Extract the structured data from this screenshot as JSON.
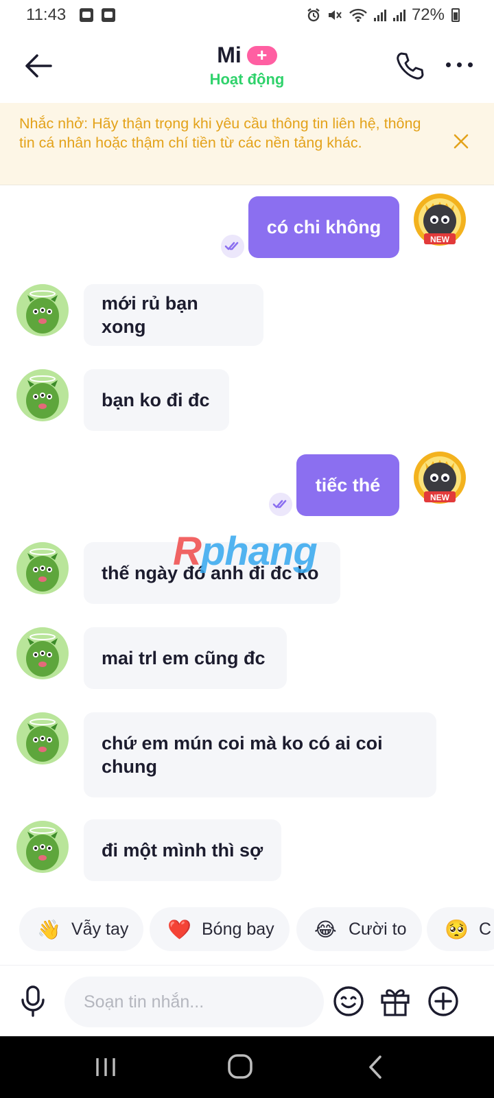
{
  "status_bar": {
    "time": "11:43",
    "battery": "72%",
    "icons": [
      "image-icon",
      "clock-icon",
      "alarm-icon",
      "mute-icon",
      "wifi-icon",
      "signal-icon",
      "signal-icon",
      "battery-icon"
    ]
  },
  "header": {
    "name": "Mi",
    "badge": "+",
    "status": "Hoạt động"
  },
  "banner": {
    "text": "Nhắc nhở: Hãy thận trọng khi yêu cầu thông tin liên hệ, thông tin cá nhân hoặc thậm chí tiền từ các nền tảng khác."
  },
  "messages": [
    {
      "side": "out",
      "text": "có chi không"
    },
    {
      "side": "in",
      "text": "mới rủ bạn xong"
    },
    {
      "side": "in",
      "text": "bạn ko đi đc"
    },
    {
      "side": "out",
      "text": "tiếc thé"
    },
    {
      "side": "in",
      "text": "thế ngày đó anh đi đc ko"
    },
    {
      "side": "in",
      "text": "mai trl em cũng đc"
    },
    {
      "side": "in",
      "text": "chứ em mún coi mà ko có ai coi chung"
    },
    {
      "side": "in",
      "text": "đi một mình thì sợ"
    }
  ],
  "watermark": {
    "first": "R",
    "rest": "phang"
  },
  "avatar_badge": "NEW",
  "quick_reactions": [
    {
      "emoji": "👋",
      "label": "Vẫy tay"
    },
    {
      "emoji": "❤️",
      "label": "Bóng bay"
    },
    {
      "emoji": "😂",
      "label": "Cười to"
    },
    {
      "emoji": "🥺",
      "label": "C"
    }
  ],
  "composer": {
    "placeholder": "Soạn tin nhắn...",
    "value": ""
  },
  "colors": {
    "accent": "#8b6ff0",
    "active_green": "#2fd26b",
    "banner_text": "#e3a21a",
    "banner_bg": "#fdf6e6",
    "badge_pink": "#ff5fa2"
  }
}
